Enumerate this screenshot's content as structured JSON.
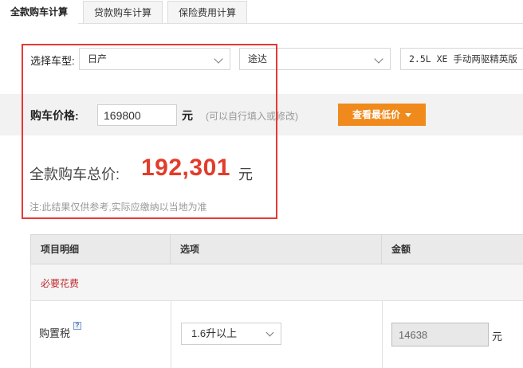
{
  "tabs": [
    {
      "label": "全款购车计算",
      "active": true
    },
    {
      "label": "贷款购车计算",
      "active": false
    },
    {
      "label": "保险费用计算",
      "active": false
    }
  ],
  "model": {
    "label": "选择车型:",
    "brand": "日产",
    "series": "途达",
    "trim": "2.5L XE 手动两驱精英版"
  },
  "price": {
    "label": "购车价格:",
    "value": "169800",
    "unit": "元",
    "hint": "(可以自行填入或修改)",
    "lowest_button": "查看最低价"
  },
  "total": {
    "label": "全款购车总价:",
    "value": "192,301",
    "unit": "元",
    "note": "注:此结果仅供参考,实际应缴纳以当地为准"
  },
  "table": {
    "headers": [
      "项目明细",
      "选项",
      "金额"
    ],
    "section": "必要花费",
    "rows": [
      {
        "label": "购置税",
        "help": "?",
        "option": "1.6升以上",
        "amount": "14638",
        "unit": "元"
      }
    ]
  },
  "colors": {
    "accent_orange": "#f08a1c",
    "total_red": "#e23c2b",
    "section_red": "#c0272d",
    "highlight_red": "#e53935"
  }
}
